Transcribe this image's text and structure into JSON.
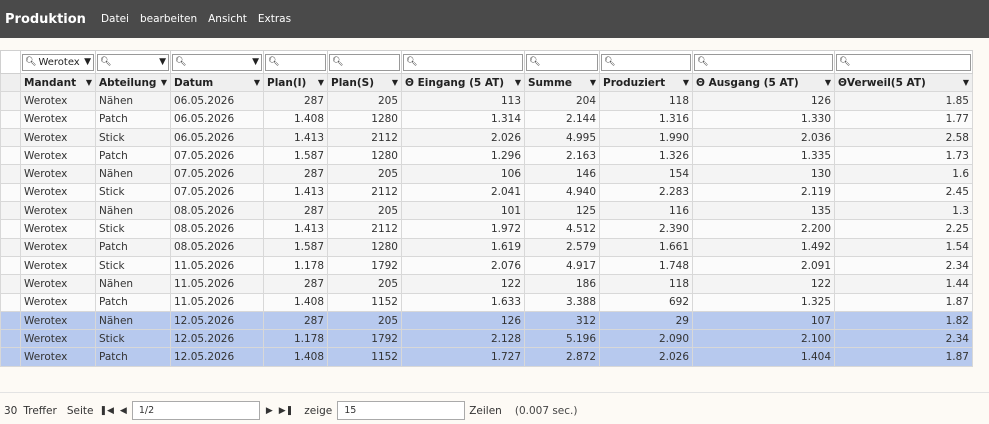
{
  "app": {
    "title": "Produktion"
  },
  "menu": [
    "Datei",
    "bearbeiten",
    "Ansicht",
    "Extras"
  ],
  "filters": [
    "Werotex",
    "",
    "",
    "",
    "",
    "",
    "",
    "",
    "",
    ""
  ],
  "columns": [
    "Mandant",
    "Abteilung",
    "Datum",
    "Plan(I)",
    "Plan(S)",
    "Θ Eingang (5 AT)",
    "Summe",
    "Produziert",
    "Θ Ausgang (5 AT)",
    "ΘVerweil(5 AT)"
  ],
  "rows": [
    [
      "Werotex",
      "Nähen",
      "06.05.2026",
      "287",
      "205",
      "113",
      "204",
      "118",
      "126",
      "1.85"
    ],
    [
      "Werotex",
      "Patch",
      "06.05.2026",
      "1.408",
      "1280",
      "1.314",
      "2.144",
      "1.316",
      "1.330",
      "1.77"
    ],
    [
      "Werotex",
      "Stick",
      "06.05.2026",
      "1.413",
      "2112",
      "2.026",
      "4.995",
      "1.990",
      "2.036",
      "2.58"
    ],
    [
      "Werotex",
      "Patch",
      "07.05.2026",
      "1.587",
      "1280",
      "1.296",
      "2.163",
      "1.326",
      "1.335",
      "1.73"
    ],
    [
      "Werotex",
      "Nähen",
      "07.05.2026",
      "287",
      "205",
      "106",
      "146",
      "154",
      "130",
      "1.6"
    ],
    [
      "Werotex",
      "Stick",
      "07.05.2026",
      "1.413",
      "2112",
      "2.041",
      "4.940",
      "2.283",
      "2.119",
      "2.45"
    ],
    [
      "Werotex",
      "Nähen",
      "08.05.2026",
      "287",
      "205",
      "101",
      "125",
      "116",
      "135",
      "1.3"
    ],
    [
      "Werotex",
      "Stick",
      "08.05.2026",
      "1.413",
      "2112",
      "1.972",
      "4.512",
      "2.390",
      "2.200",
      "2.25"
    ],
    [
      "Werotex",
      "Patch",
      "08.05.2026",
      "1.587",
      "1280",
      "1.619",
      "2.579",
      "1.661",
      "1.492",
      "1.54"
    ],
    [
      "Werotex",
      "Stick",
      "11.05.2026",
      "1.178",
      "1792",
      "2.076",
      "4.917",
      "1.748",
      "2.091",
      "2.34"
    ],
    [
      "Werotex",
      "Nähen",
      "11.05.2026",
      "287",
      "205",
      "122",
      "186",
      "118",
      "122",
      "1.44"
    ],
    [
      "Werotex",
      "Patch",
      "11.05.2026",
      "1.408",
      "1152",
      "1.633",
      "3.388",
      "692",
      "1.325",
      "1.87"
    ],
    [
      "Werotex",
      "Nähen",
      "12.05.2026",
      "287",
      "205",
      "126",
      "312",
      "29",
      "107",
      "1.82"
    ],
    [
      "Werotex",
      "Stick",
      "12.05.2026",
      "1.178",
      "1792",
      "2.128",
      "5.196",
      "2.090",
      "2.100",
      "2.34"
    ],
    [
      "Werotex",
      "Patch",
      "12.05.2026",
      "1.408",
      "1152",
      "1.727",
      "2.872",
      "2.026",
      "1.404",
      "1.87"
    ]
  ],
  "selected_rows": [
    12,
    13,
    14
  ],
  "footer": {
    "count": "30",
    "hits_label": "Treffer",
    "page_label": "Seite",
    "page_value": "1/2",
    "show_label": "zeige",
    "rows_value": "15",
    "rows_label": "Zeilen",
    "time": "(0.007 sec.)"
  },
  "colors": {
    "topbar": "#4a4a4a",
    "selected_row": "#b7c9ee",
    "header_bg": "#efefef"
  }
}
